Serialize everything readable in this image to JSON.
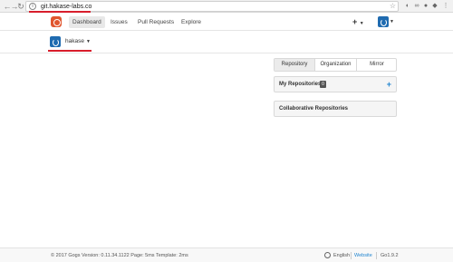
{
  "browser": {
    "url": "git.hakase-labs.co",
    "back_icon": "arrow-left-icon",
    "forward_icon": "arrow-right-icon",
    "reload_icon": "reload-icon"
  },
  "header": {
    "nav": [
      "Dashboard",
      "Issues",
      "Pull Requests",
      "Explore"
    ],
    "create": "+"
  },
  "context": {
    "user": "hakase"
  },
  "panel": {
    "tabs": [
      "Repository",
      "Organization",
      "Mirror"
    ],
    "my_repos_title": "My Repositories",
    "my_repos_count": "0",
    "add": "+",
    "collab_title": "Collaborative Repositories"
  },
  "footer": {
    "copyright": "© 2017 Gogs Version: 0.11.34.1122 Page: 5ms Template: 2ms",
    "language": "English",
    "website": "Website",
    "go_version": "Go1.9.2"
  },
  "colors": {
    "accent": "#2185d0",
    "logo": "#e0562f",
    "highlight_red": "#d81e2c"
  }
}
